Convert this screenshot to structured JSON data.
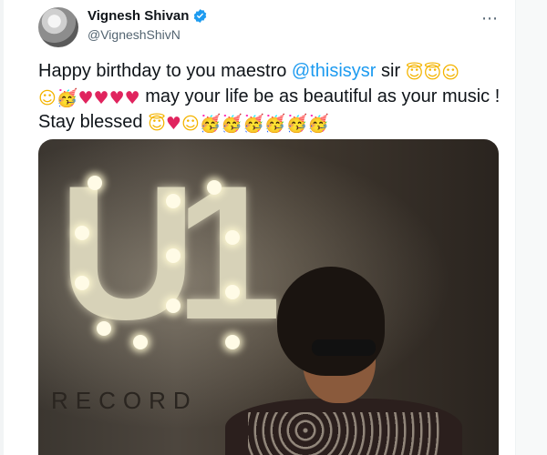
{
  "tweet": {
    "display_name": "Vignesh Shivan",
    "handle": "@VigneshShivN",
    "verified": true,
    "more_icon": "more-dots-icon",
    "text": {
      "part1": "Happy birthday to you maestro ",
      "mention": "@thisisysr",
      "part2": " sir ",
      "part3": " may your life be as beautiful as your music ! Stay blessed "
    },
    "emojis": {
      "halo": "😇",
      "blush": "☺",
      "party": "🥳",
      "heart": "♥"
    },
    "media": {
      "sign_letters": [
        "U",
        "1"
      ],
      "sign_word": "RECORD"
    }
  },
  "colors": {
    "link": "#1d9bf0",
    "text": "#0f1419",
    "secondary": "#536471",
    "heart": "#e0245e"
  }
}
